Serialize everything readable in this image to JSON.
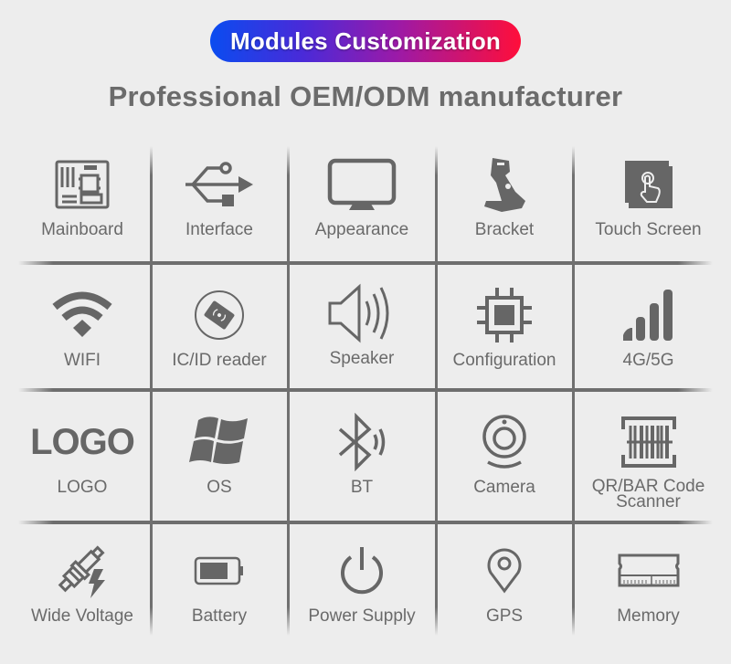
{
  "header": {
    "banner_title": "Modules Customization",
    "subtitle": "Professional OEM/ODM manufacturer"
  },
  "colors": {
    "banner_gradient_start": "#0a4cf0",
    "banner_gradient_end": "#ff0e3a",
    "icon_gray": "#666666",
    "background": "#ededed"
  },
  "modules": [
    {
      "label": "Mainboard",
      "icon": "mainboard-icon"
    },
    {
      "label": "Interface",
      "icon": "usb-icon"
    },
    {
      "label": "Appearance",
      "icon": "monitor-icon"
    },
    {
      "label": "Bracket",
      "icon": "bracket-stand-icon"
    },
    {
      "label": "Touch Screen",
      "icon": "touch-screen-icon"
    },
    {
      "label": "WIFI",
      "icon": "wifi-icon"
    },
    {
      "label": "IC/ID reader",
      "icon": "nfc-card-reader-icon"
    },
    {
      "label": "Speaker",
      "icon": "speaker-icon"
    },
    {
      "label": "Configuration",
      "icon": "cpu-chip-icon"
    },
    {
      "label": "4G/5G",
      "icon": "signal-bars-icon"
    },
    {
      "label": "LOGO",
      "icon": "logo-text-icon",
      "icon_text": "LOGO"
    },
    {
      "label": "OS",
      "icon": "windows-icon"
    },
    {
      "label": "BT",
      "icon": "bluetooth-icon"
    },
    {
      "label": "Camera",
      "icon": "webcam-icon"
    },
    {
      "label": "QR/BAR Code\nScanner",
      "icon": "barcode-scanner-icon"
    },
    {
      "label": "Wide Voltage",
      "icon": "spark-plug-voltage-icon"
    },
    {
      "label": "Battery",
      "icon": "battery-icon"
    },
    {
      "label": "Power Supply",
      "icon": "power-icon"
    },
    {
      "label": "GPS",
      "icon": "map-pin-icon"
    },
    {
      "label": "Memory",
      "icon": "memory-module-icon"
    }
  ]
}
